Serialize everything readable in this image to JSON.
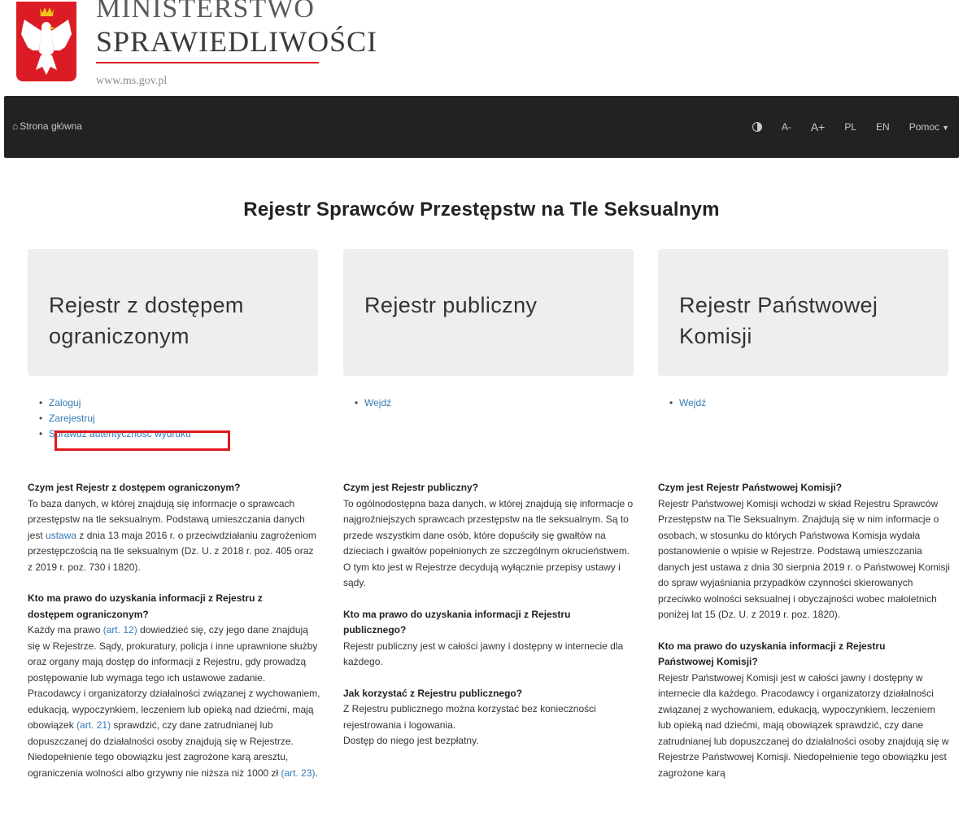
{
  "header": {
    "ministry_line1": "MINISTERSTWO",
    "ministry_line2": "SPRAWIEDLIWOŚCI",
    "url": "www.ms.gov.pl"
  },
  "navbar": {
    "home_label": "Strona główna",
    "font_decrease": "A-",
    "font_increase": "A+",
    "lang_pl": "PL",
    "lang_en": "EN",
    "help_label": "Pomoc",
    "colors": {
      "background": "#222222",
      "text": "#c8c8c8"
    }
  },
  "page_title": "Rejestr Sprawców Przestępstw na Tle Seksualnym",
  "columns": [
    {
      "title": "Rejestr z dostępem ograniczonym",
      "links": [
        "Zaloguj",
        "Zarejestruj",
        "Sprawdź autentyczność wydruku"
      ],
      "q1": "Czym jest Rejestr z dostępem ograniczonym?",
      "a1_part1": "To baza danych, w której znajdują się informacje o sprawcach przestępstw na tle seksualnym. Podstawą umieszczania danych jest ",
      "a1_link": "ustawa",
      "a1_part2": " z dnia 13 maja 2016 r. o przeciwdziałaniu zagrożeniom przestępczością na tle seksualnym (Dz. U. z 2018 r. poz. 405 oraz z 2019 r. poz. 730 i 1820).",
      "q2": "Kto ma prawo do uzyskania informacji z Rejestru z dostępem ograniczonym?",
      "a2_part1": "Każdy ma prawo ",
      "a2_link1": "(art. 12)",
      "a2_part2": " dowiedzieć się, czy jego dane znajdują się w Rejestrze. Sądy, prokuratury, policja i inne uprawnione służby oraz organy mają dostęp do informacji z Rejestru, gdy prowadzą postępowanie lub wymaga tego ich ustawowe zadanie. Pracodawcy i organizatorzy działalności związanej z wychowaniem, edukacją, wypoczynkiem, leczeniem lub opieką nad dziećmi, mają obowiązek ",
      "a2_link2": "(art. 21)",
      "a2_part3": " sprawdzić, czy dane zatrudnianej lub dopuszczanej do działalności osoby znajdują się w Rejestrze. Niedopełnienie tego obowiązku jest zagrożone karą aresztu, ograniczenia wolności albo grzywny nie niższa niż 1000 zł ",
      "a2_link3": "(art. 23)",
      "a2_part4": "."
    },
    {
      "title": "Rejestr publiczny",
      "links": [
        "Wejdź"
      ],
      "q1": "Czym jest Rejestr publiczny?",
      "a1": "To ogólnodostępna baza danych, w której znajdują się informacje o najgroźniejszych sprawcach przestępstw na tle seksualnym. Są to przede wszystkim dane osób, które dopuściły się gwałtów na dzieciach i gwałtów popełnionych ze szczególnym okrucieństwem.",
      "a1b": "O tym kto jest w Rejestrze decydują wyłącznie przepisy ustawy i sądy.",
      "q2": "Kto ma prawo do uzyskania informacji z Rejestru publicznego?",
      "a2": "Rejestr publiczny jest w całości jawny i dostępny w internecie dla każdego.",
      "q3": "Jak korzystać z Rejestru publicznego?",
      "a3": "Z Rejestru publicznego można korzystać bez konieczności rejestrowania i logowania.",
      "a3b": "Dostęp do niego jest bezpłatny."
    },
    {
      "title": "Rejestr Państwowej Komisji",
      "links": [
        "Wejdź"
      ],
      "q1": "Czym jest Rejestr Państwowej Komisji?",
      "a1": "Rejestr Państwowej Komisji wchodzi w skład Rejestru Sprawców Przestępstw na Tle Seksualnym. Znajdują się w nim informacje o osobach, w stosunku do których Państwowa Komisja wydała postanowienie o wpisie w Rejestrze. Podstawą umieszczania danych jest ustawa z dnia 30 sierpnia 2019 r. o Państwowej Komisji do spraw wyjaśniania przypadków czynności skierowanych przeciwko wolności seksualnej i obyczajności wobec małoletnich poniżej lat 15 (Dz. U. z 2019 r. poz. 1820).",
      "q2": "Kto ma prawo do uzyskania informacji z Rejestru Państwowej Komisji?",
      "a2": "Rejestr Państwowej Komisji jest w całości jawny i dostępny w internecie dla każdego. Pracodawcy i organizatorzy działalności związanej z wychowaniem, edukacją, wypoczynkiem, leczeniem lub opieką nad dziećmi, mają obowiązek sprawdzić, czy dane zatrudnianej lub dopuszczanej do działalności osoby znajdują się w Rejestrze Państwowej Komisji. Niedopełnienie tego obowiązku jest zagrożone karą"
    }
  ],
  "colors": {
    "link": "#337ab7",
    "highlight_box": "#e0191f",
    "emblem": "#dc1c24",
    "jumbotron": "#eeeeee"
  },
  "icons": {
    "home": "home-icon",
    "contrast": "contrast-icon",
    "dropdown": "caret-down-icon",
    "emblem": "polish-eagle-emblem"
  }
}
